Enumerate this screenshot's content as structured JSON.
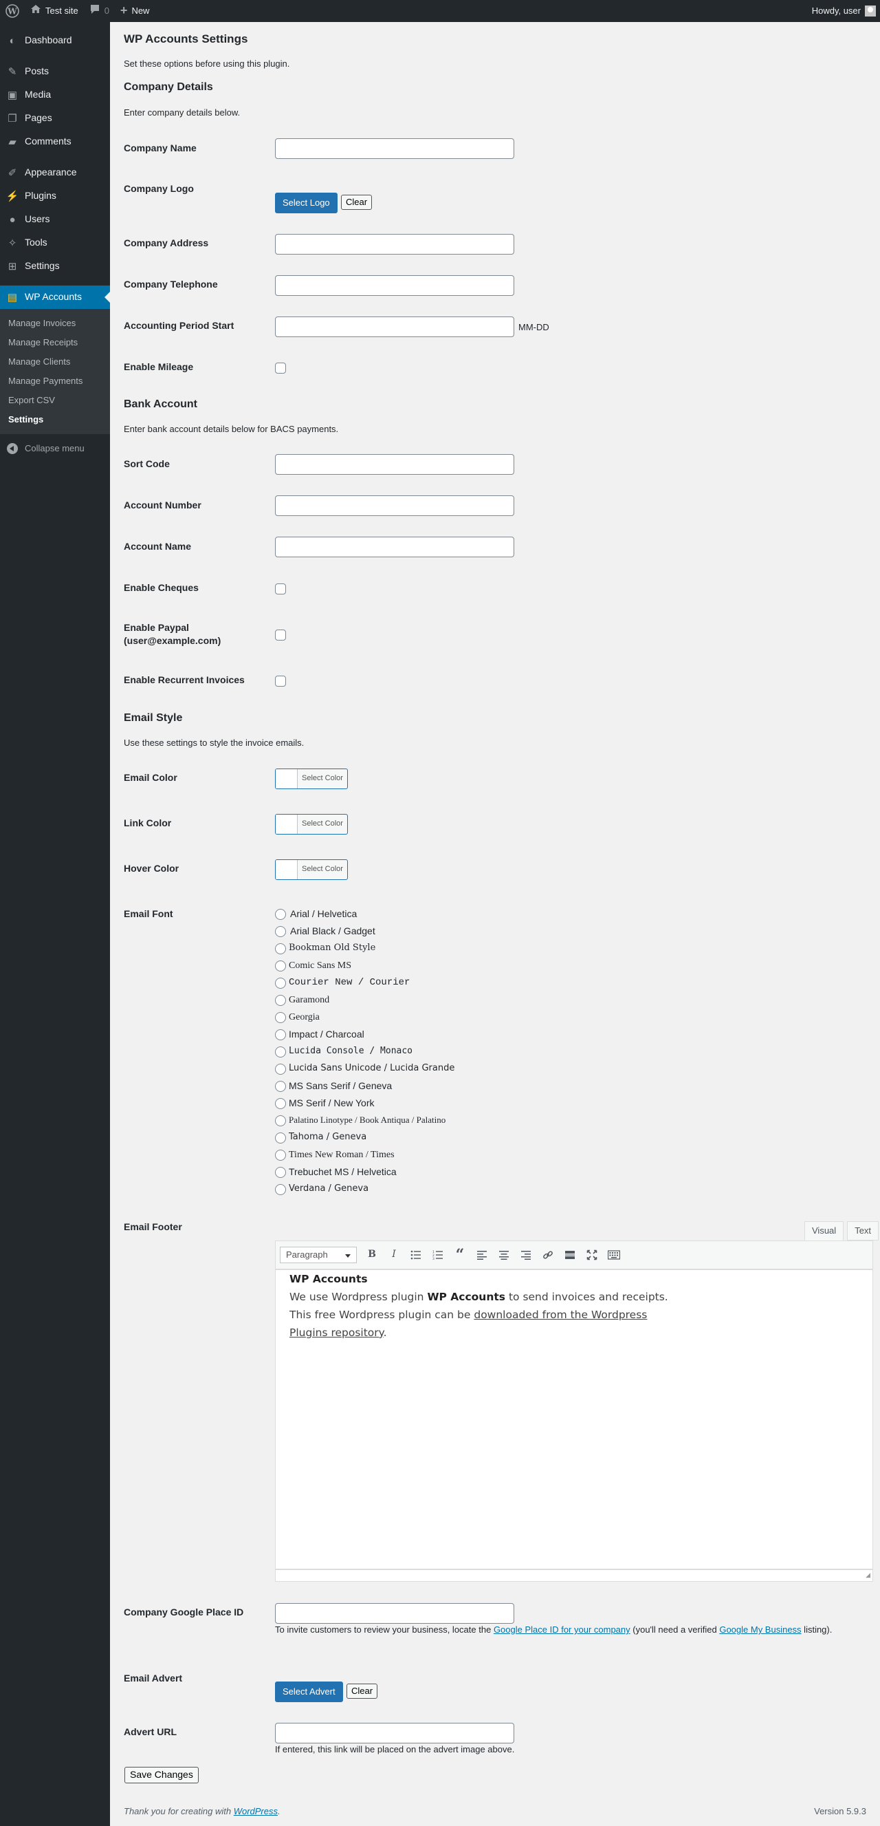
{
  "adminbar": {
    "site_name": "Test site",
    "comments_count": "0",
    "new_label": "New",
    "howdy": "Howdy, user"
  },
  "sidebar": {
    "items": [
      {
        "label": "Dashboard",
        "icon": "dashboard-icon"
      },
      {
        "label": "Posts",
        "icon": "pin-icon"
      },
      {
        "label": "Media",
        "icon": "media-icon"
      },
      {
        "label": "Pages",
        "icon": "pages-icon"
      },
      {
        "label": "Comments",
        "icon": "comment-icon"
      },
      {
        "label": "Appearance",
        "icon": "brush-icon"
      },
      {
        "label": "Plugins",
        "icon": "plugin-icon"
      },
      {
        "label": "Users",
        "icon": "user-icon"
      },
      {
        "label": "Tools",
        "icon": "wrench-icon"
      },
      {
        "label": "Settings",
        "icon": "settings-icon"
      },
      {
        "label": "WP Accounts",
        "icon": "wp-accounts-icon"
      }
    ],
    "submenu": [
      "Manage Invoices",
      "Manage Receipts",
      "Manage Clients",
      "Manage Payments",
      "Export CSV",
      "Settings"
    ],
    "collapse": "Collapse menu"
  },
  "page": {
    "title": "WP Accounts Settings",
    "intro": "Set these options before using this plugin."
  },
  "company": {
    "heading": "Company Details",
    "intro": "Enter company details below.",
    "name_label": "Company Name",
    "logo_label": "Company Logo",
    "select_logo": "Select Logo",
    "clear": "Clear",
    "address_label": "Company Address",
    "telephone_label": "Company Telephone",
    "period_label": "Accounting Period Start",
    "period_hint": "MM-DD",
    "mileage_label": "Enable Mileage"
  },
  "bank": {
    "heading": "Bank Account",
    "intro": "Enter bank account details below for BACS payments.",
    "sort_code_label": "Sort Code",
    "account_number_label": "Account Number",
    "account_name_label": "Account Name",
    "cheques_label": "Enable Cheques",
    "paypal_label_line1": "Enable Paypal",
    "paypal_label_line2": "(user@example.com)",
    "recurrent_label": "Enable Recurrent Invoices"
  },
  "email": {
    "heading": "Email Style",
    "intro": "Use these settings to style the invoice emails.",
    "color_label": "Email Color",
    "link_color_label": "Link Color",
    "hover_color_label": "Hover Color",
    "select_color": "Select Color",
    "font_label": "Email Font",
    "fonts": [
      "Arial / Helvetica",
      "Arial Black / Gadget",
      "Bookman Old Style",
      "Comic Sans MS",
      "Courier New / Courier",
      "Garamond",
      "Georgia",
      "Impact / Charcoal",
      "Lucida Console / Monaco",
      "Lucida Sans Unicode / Lucida Grande",
      "MS Sans Serif / Geneva",
      "MS Serif / New York",
      "Palatino Linotype / Book Antiqua / Palatino",
      "Tahoma / Geneva",
      "Times New Roman / Times",
      "Trebuchet MS / Helvetica",
      "Verdana / Geneva"
    ],
    "footer_label": "Email Footer"
  },
  "editor": {
    "tab_visual": "Visual",
    "tab_text": "Text",
    "format": "Paragraph",
    "content_heading": "WP Accounts",
    "content_p1": "We use Wordpress plugin ",
    "content_strong": "WP Accounts",
    "content_p2": " to send invoices and receipts. This free Wordpress plugin can be ",
    "content_link": "downloaded from the Wordpress Plugins repository",
    "content_end": "."
  },
  "google": {
    "label": "Company Google Place ID",
    "help_1": "To invite customers to review your business, locate the ",
    "help_link1": "Google Place ID for your company",
    "help_2": " (you'll need a verified ",
    "help_link2": "Google My Business",
    "help_3": " listing)."
  },
  "advert": {
    "label": "Email Advert",
    "select": "Select Advert",
    "clear": "Clear",
    "url_label": "Advert URL",
    "url_help": "If entered, this link will be placed on the advert image above."
  },
  "save": "Save Changes",
  "footer": {
    "thanks": "Thank you for creating with ",
    "link": "WordPress",
    "dot": ".",
    "version": "Version 5.9.3"
  }
}
